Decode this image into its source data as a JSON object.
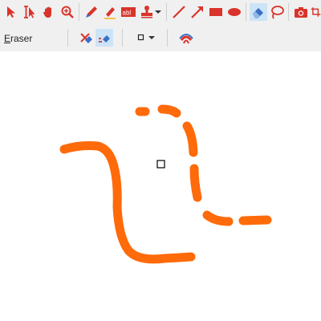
{
  "toolbar": {
    "tools": [
      {
        "name": "select-pointer-icon"
      },
      {
        "name": "text-select-icon"
      },
      {
        "name": "pan-hand-icon"
      },
      {
        "name": "zoom-icon"
      },
      {
        "name": "pen-icon"
      },
      {
        "name": "highlighter-icon"
      },
      {
        "name": "text-field-icon"
      },
      {
        "name": "stamp-icon"
      },
      {
        "name": "line-icon"
      },
      {
        "name": "arrow-icon"
      },
      {
        "name": "rectangle-icon"
      },
      {
        "name": "ellipse-icon"
      },
      {
        "name": "eraser-icon"
      },
      {
        "name": "lasso-icon"
      },
      {
        "name": "snapshot-icon"
      },
      {
        "name": "crop-icon"
      }
    ],
    "active_tool": "eraser-icon",
    "accent_color": "#d9342b",
    "active_bg": "#cce4f7"
  },
  "options_bar": {
    "tool_label": "Eraser",
    "buttons": [
      {
        "name": "erase-whole-stroke-icon"
      },
      {
        "name": "erase-partial-icon"
      },
      {
        "name": "eraser-size-icon"
      },
      {
        "name": "eraser-size-dropdown-icon"
      },
      {
        "name": "rainbow-color-icon"
      }
    ]
  },
  "canvas": {
    "stroke_color": "#ff6a0a"
  }
}
